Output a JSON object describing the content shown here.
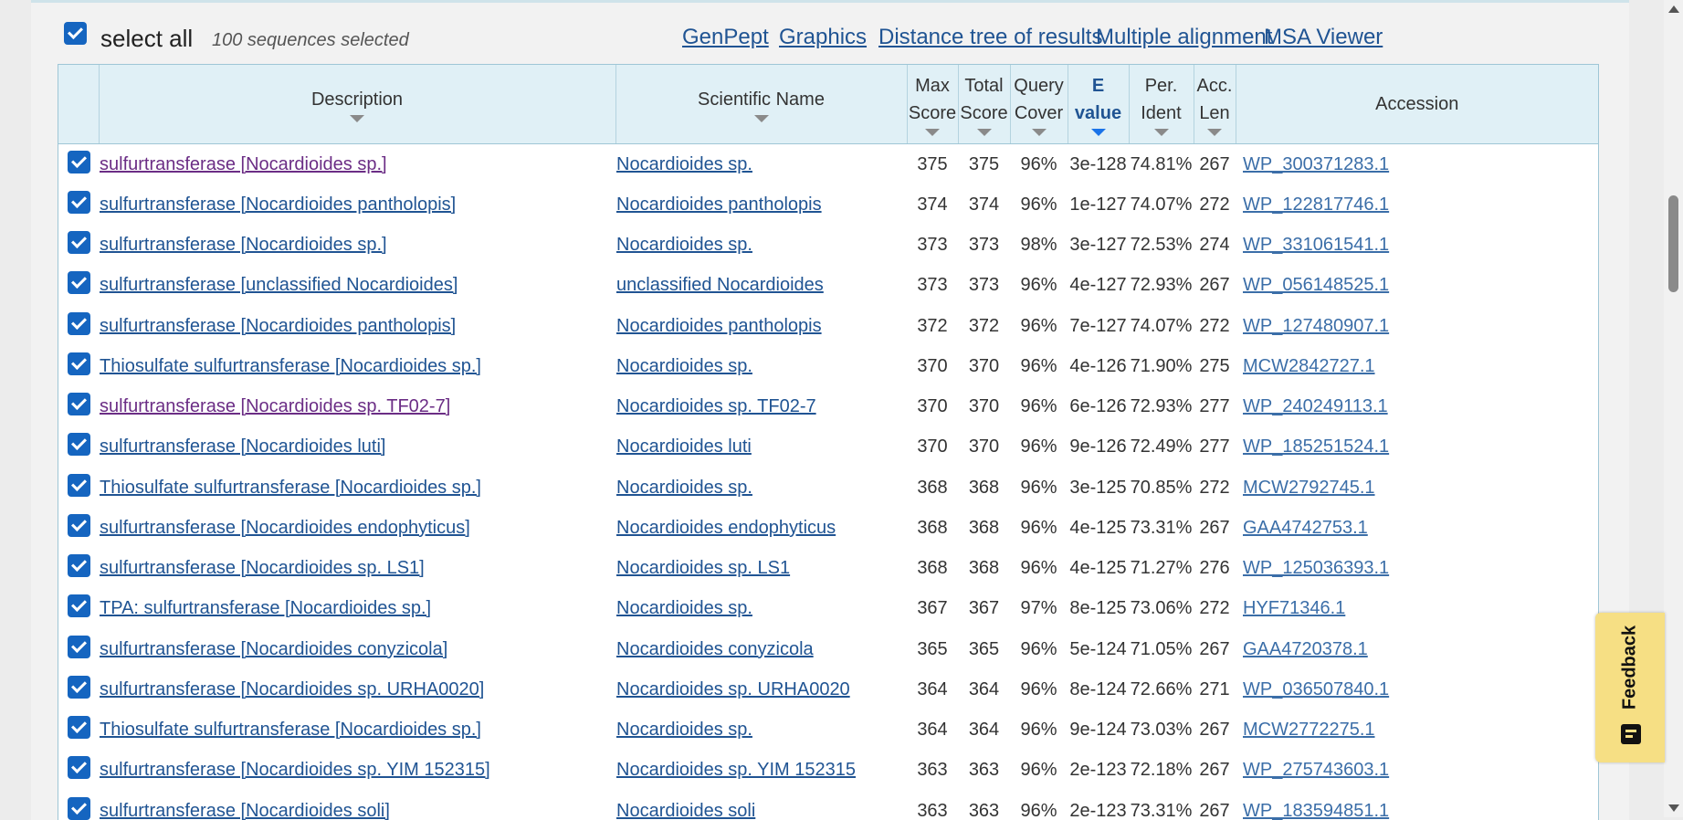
{
  "toolbar": {
    "select_all_label": "select all",
    "selected_count": "100 sequences selected",
    "links": [
      "GenPept",
      "Graphics",
      "Distance tree of results",
      "Multiple alignment",
      "MSA Viewer"
    ]
  },
  "table": {
    "headers": {
      "description": "Description",
      "scientific_name": "Scientific Name",
      "max_score": [
        "Max",
        "Score"
      ],
      "total_score": [
        "Total",
        "Score"
      ],
      "query_cover": [
        "Query",
        "Cover"
      ],
      "e_value": [
        "E",
        "value"
      ],
      "per_ident": [
        "Per.",
        "Ident"
      ],
      "acc_len": [
        "Acc.",
        "Len"
      ],
      "accession": "Accession"
    },
    "sorted_column": "e_value",
    "rows": [
      {
        "description": "sulfurtransferase [Nocardioides sp.]",
        "scientific_name": "Nocardioides sp.",
        "max_score": "375",
        "total_score": "375",
        "query_cover": "96%",
        "e_value": "3e-128",
        "per_ident": "74.81%",
        "acc_len": "267",
        "accession": "WP_300371283.1",
        "visited": true
      },
      {
        "description": "sulfurtransferase [Nocardioides pantholopis]",
        "scientific_name": "Nocardioides pantholopis",
        "max_score": "374",
        "total_score": "374",
        "query_cover": "96%",
        "e_value": "1e-127",
        "per_ident": "74.07%",
        "acc_len": "272",
        "accession": "WP_122817746.1",
        "visited": false
      },
      {
        "description": "sulfurtransferase [Nocardioides sp.]",
        "scientific_name": "Nocardioides sp.",
        "max_score": "373",
        "total_score": "373",
        "query_cover": "98%",
        "e_value": "3e-127",
        "per_ident": "72.53%",
        "acc_len": "274",
        "accession": "WP_331061541.1",
        "visited": false
      },
      {
        "description": "sulfurtransferase [unclassified Nocardioides]",
        "scientific_name": "unclassified Nocardioides",
        "max_score": "373",
        "total_score": "373",
        "query_cover": "96%",
        "e_value": "4e-127",
        "per_ident": "72.93%",
        "acc_len": "267",
        "accession": "WP_056148525.1",
        "visited": false
      },
      {
        "description": "sulfurtransferase [Nocardioides pantholopis]",
        "scientific_name": "Nocardioides pantholopis",
        "max_score": "372",
        "total_score": "372",
        "query_cover": "96%",
        "e_value": "7e-127",
        "per_ident": "74.07%",
        "acc_len": "272",
        "accession": "WP_127480907.1",
        "visited": false
      },
      {
        "description": "Thiosulfate sulfurtransferase [Nocardioides sp.]",
        "scientific_name": "Nocardioides sp.",
        "max_score": "370",
        "total_score": "370",
        "query_cover": "96%",
        "e_value": "4e-126",
        "per_ident": "71.90%",
        "acc_len": "275",
        "accession": "MCW2842727.1",
        "visited": false
      },
      {
        "description": "sulfurtransferase [Nocardioides sp. TF02-7]",
        "scientific_name": "Nocardioides sp. TF02-7",
        "max_score": "370",
        "total_score": "370",
        "query_cover": "96%",
        "e_value": "6e-126",
        "per_ident": "72.93%",
        "acc_len": "277",
        "accession": "WP_240249113.1",
        "visited": true
      },
      {
        "description": "sulfurtransferase [Nocardioides luti]",
        "scientific_name": "Nocardioides luti",
        "max_score": "370",
        "total_score": "370",
        "query_cover": "96%",
        "e_value": "9e-126",
        "per_ident": "72.49%",
        "acc_len": "277",
        "accession": "WP_185251524.1",
        "visited": false
      },
      {
        "description": "Thiosulfate sulfurtransferase [Nocardioides sp.]",
        "scientific_name": "Nocardioides sp.",
        "max_score": "368",
        "total_score": "368",
        "query_cover": "96%",
        "e_value": "3e-125",
        "per_ident": "70.85%",
        "acc_len": "272",
        "accession": "MCW2792745.1",
        "visited": false
      },
      {
        "description": "sulfurtransferase [Nocardioides endophyticus]",
        "scientific_name": "Nocardioides endophyticus",
        "max_score": "368",
        "total_score": "368",
        "query_cover": "96%",
        "e_value": "4e-125",
        "per_ident": "73.31%",
        "acc_len": "267",
        "accession": "GAA4742753.1",
        "visited": false
      },
      {
        "description": "sulfurtransferase [Nocardioides sp. LS1]",
        "scientific_name": "Nocardioides sp. LS1",
        "max_score": "368",
        "total_score": "368",
        "query_cover": "96%",
        "e_value": "4e-125",
        "per_ident": "71.27%",
        "acc_len": "276",
        "accession": "WP_125036393.1",
        "visited": false
      },
      {
        "description": "TPA: sulfurtransferase [Nocardioides sp.]",
        "scientific_name": "Nocardioides sp.",
        "max_score": "367",
        "total_score": "367",
        "query_cover": "97%",
        "e_value": "8e-125",
        "per_ident": "73.06%",
        "acc_len": "272",
        "accession": "HYF71346.1",
        "visited": false
      },
      {
        "description": "sulfurtransferase [Nocardioides conyzicola]",
        "scientific_name": "Nocardioides conyzicola",
        "max_score": "365",
        "total_score": "365",
        "query_cover": "96%",
        "e_value": "5e-124",
        "per_ident": "71.05%",
        "acc_len": "267",
        "accession": "GAA4720378.1",
        "visited": false
      },
      {
        "description": "sulfurtransferase [Nocardioides sp. URHA0020]",
        "scientific_name": "Nocardioides sp. URHA0020",
        "max_score": "364",
        "total_score": "364",
        "query_cover": "96%",
        "e_value": "8e-124",
        "per_ident": "72.66%",
        "acc_len": "271",
        "accession": "WP_036507840.1",
        "visited": false
      },
      {
        "description": "Thiosulfate sulfurtransferase [Nocardioides sp.]",
        "scientific_name": "Nocardioides sp.",
        "max_score": "364",
        "total_score": "364",
        "query_cover": "96%",
        "e_value": "9e-124",
        "per_ident": "73.03%",
        "acc_len": "267",
        "accession": "MCW2772275.1",
        "visited": false
      },
      {
        "description": "sulfurtransferase [Nocardioides sp. YIM 152315]",
        "scientific_name": "Nocardioides sp. YIM 152315",
        "max_score": "363",
        "total_score": "363",
        "query_cover": "96%",
        "e_value": "2e-123",
        "per_ident": "72.18%",
        "acc_len": "267",
        "accession": "WP_275743603.1",
        "visited": false
      },
      {
        "description": "sulfurtransferase [Nocardioides soli]",
        "scientific_name": "Nocardioides soli",
        "max_score": "363",
        "total_score": "363",
        "query_cover": "96%",
        "e_value": "2e-123",
        "per_ident": "73.31%",
        "acc_len": "267",
        "accession": "WP_183594851.1",
        "visited": false
      }
    ]
  },
  "feedback": {
    "label": "Feedback"
  },
  "colors": {
    "link": "#205493",
    "visited_link": "#6b2d85",
    "checkbox": "#1565c0",
    "header_bg": "#e0f0f6",
    "feedback_bg": "#f6df84"
  }
}
